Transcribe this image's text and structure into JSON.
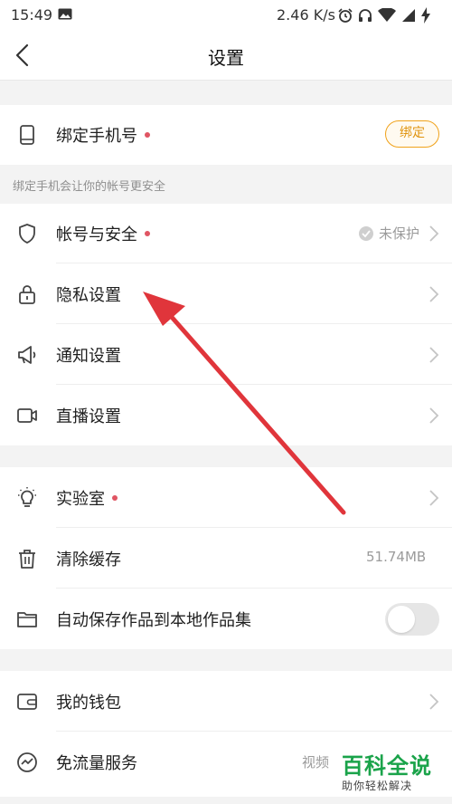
{
  "status_bar": {
    "time": "15:49",
    "network_speed": "2.46 K/s",
    "icons": [
      "image-icon",
      "alarm-icon",
      "headphone-icon",
      "wifi-icon",
      "signal-icon",
      "charging-icon"
    ]
  },
  "header": {
    "title": "设置",
    "back_icon": "chevron-left-icon"
  },
  "section_phone": {
    "bind_phone_label": "绑定手机号",
    "bind_button": "绑定",
    "hint": "绑定手机会让你的帐号更安全"
  },
  "section_account": {
    "items": [
      {
        "label": "帐号与安全",
        "value": "未保护",
        "icon": "shield-icon"
      },
      {
        "label": "隐私设置",
        "icon": "lock-icon"
      },
      {
        "label": "通知设置",
        "icon": "megaphone-icon"
      },
      {
        "label": "直播设置",
        "icon": "video-camera-icon"
      }
    ]
  },
  "section_tools": {
    "items": [
      {
        "label": "实验室",
        "icon": "lightbulb-icon"
      },
      {
        "label": "清除缓存",
        "value": "51.74MB",
        "icon": "trash-icon"
      },
      {
        "label": "自动保存作品到本地作品集",
        "icon": "folder-icon",
        "toggle_on": false
      }
    ]
  },
  "section_wallet": {
    "items": [
      {
        "label": "我的钱包",
        "icon": "wallet-icon"
      },
      {
        "label": "免流量服务",
        "value": "视频",
        "icon": "speedometer-icon"
      }
    ]
  },
  "watermark": {
    "brand": "百科全说",
    "tagline": "助你轻松解决"
  },
  "colors": {
    "accent_orange": "#f0a21a",
    "red_dot": "#e05563",
    "arrow_red": "#e0353b",
    "watermark_green": "#1aa34a"
  }
}
